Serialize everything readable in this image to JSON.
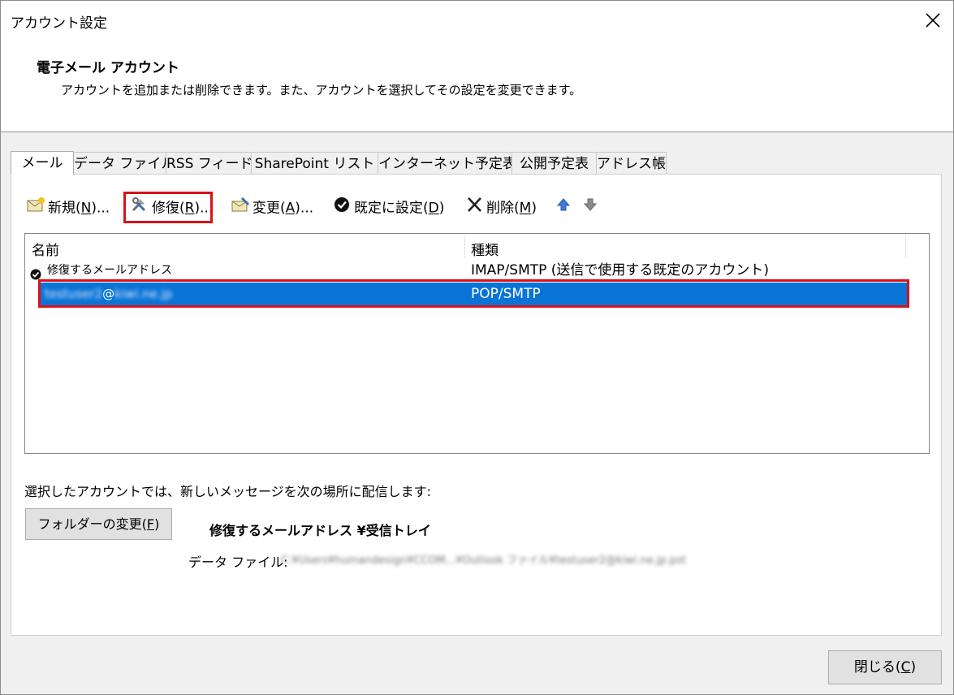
{
  "window": {
    "title": "アカウント設定",
    "close_label": "×"
  },
  "header": {
    "title": "電子メール アカウント",
    "description": "アカウントを追加または削除できます。また、アカウントを選択してその設定を変更できます。"
  },
  "tabs": [
    {
      "label": "メール",
      "active": true
    },
    {
      "label": "データ ファイル"
    },
    {
      "label": "RSS フィード"
    },
    {
      "label": "SharePoint リスト"
    },
    {
      "label": "インターネット予定表"
    },
    {
      "label": "公開予定表"
    },
    {
      "label": "アドレス帳"
    }
  ],
  "toolbar": {
    "new": {
      "pre": "新規(",
      "key": "N",
      "post": ")..."
    },
    "repair": {
      "pre": "修復(",
      "key": "R",
      "post": ")..."
    },
    "change": {
      "pre": "変更(",
      "key": "A",
      "post": ")..."
    },
    "default": {
      "pre": "既定に設定(",
      "key": "D",
      "post": ")"
    },
    "delete": {
      "pre": "削除(",
      "key": "M",
      "post": ")"
    }
  },
  "accounts": {
    "columns": [
      "名前",
      "種類"
    ],
    "rows": [
      {
        "name": "修復するメールアドレス",
        "type": "IMAP/SMTP (送信で使用する既定のアカウント)",
        "default": true
      },
      {
        "name_blur_user": "testuser2",
        "name_at": "@",
        "name_blur_domain": "kiwi.ne.jp",
        "type": "POP/SMTP",
        "selected": true
      }
    ]
  },
  "delivery": {
    "info": "選択したアカウントでは、新しいメッセージを次の場所に配信します:",
    "folder_button": {
      "pre": "フォルダーの変更(",
      "key": "F",
      "post": ")"
    },
    "folder_path": "修復するメールアドレス ¥受信トレイ",
    "data_file_label": "データ ファイル:",
    "data_file_value": "C:¥Users¥humandesign¥CCOM...¥Outlook ファイル¥testuser2@kiwi.ne.jp.pst"
  },
  "close_button": {
    "pre": "閉じる(",
    "key": "C",
    "post": ")"
  },
  "colors": {
    "selection": "#0a74d6",
    "highlight_box": "#d9111b"
  }
}
